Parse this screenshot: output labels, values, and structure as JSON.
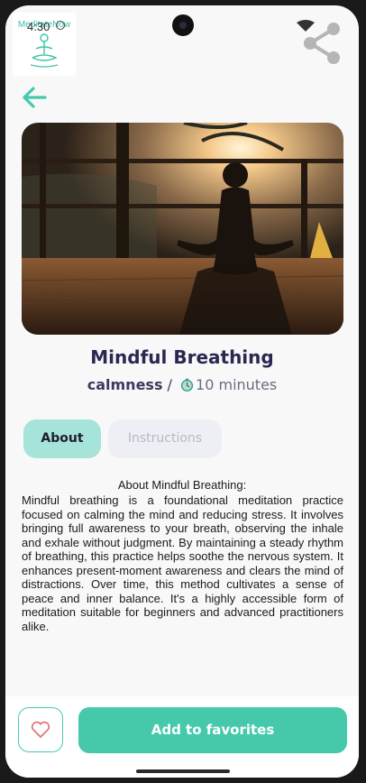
{
  "status": {
    "time": "4:30"
  },
  "logo": {
    "text": "MeditateNow",
    "icon": "meditating-figure-icon"
  },
  "header": {
    "back_icon": "arrow-left-icon",
    "share_icon": "share-icon"
  },
  "meditation": {
    "title": "Mindful Breathing",
    "category": "calmness",
    "separator": " / ",
    "duration": "10 minutes",
    "timer_icon": "timer-icon"
  },
  "tabs": [
    {
      "label": "About",
      "active": true
    },
    {
      "label": "Instructions",
      "active": false
    }
  ],
  "about": {
    "heading": "About Mindful Breathing:",
    "body": "Mindful breathing is a foundational meditation practice focused on calming the mind and reducing stress. It involves bringing full awareness to your breath, observing the inhale and exhale without judgment. By maintaining a steady rhythm of breathing, this practice helps soothe the nervous system. It enhances present-moment awareness and clears the mind of distractions. Over time, this method cultivates a sense of peace and inner balance. It's a highly accessible form of meditation suitable for beginners and advanced practitioners alike."
  },
  "actions": {
    "favorite_icon": "heart-icon",
    "add_to_favorites": "Add to favorites"
  },
  "colors": {
    "accent": "#45c9aa",
    "tab_active_bg": "#a6e3d9",
    "title_text": "#2a2850"
  }
}
